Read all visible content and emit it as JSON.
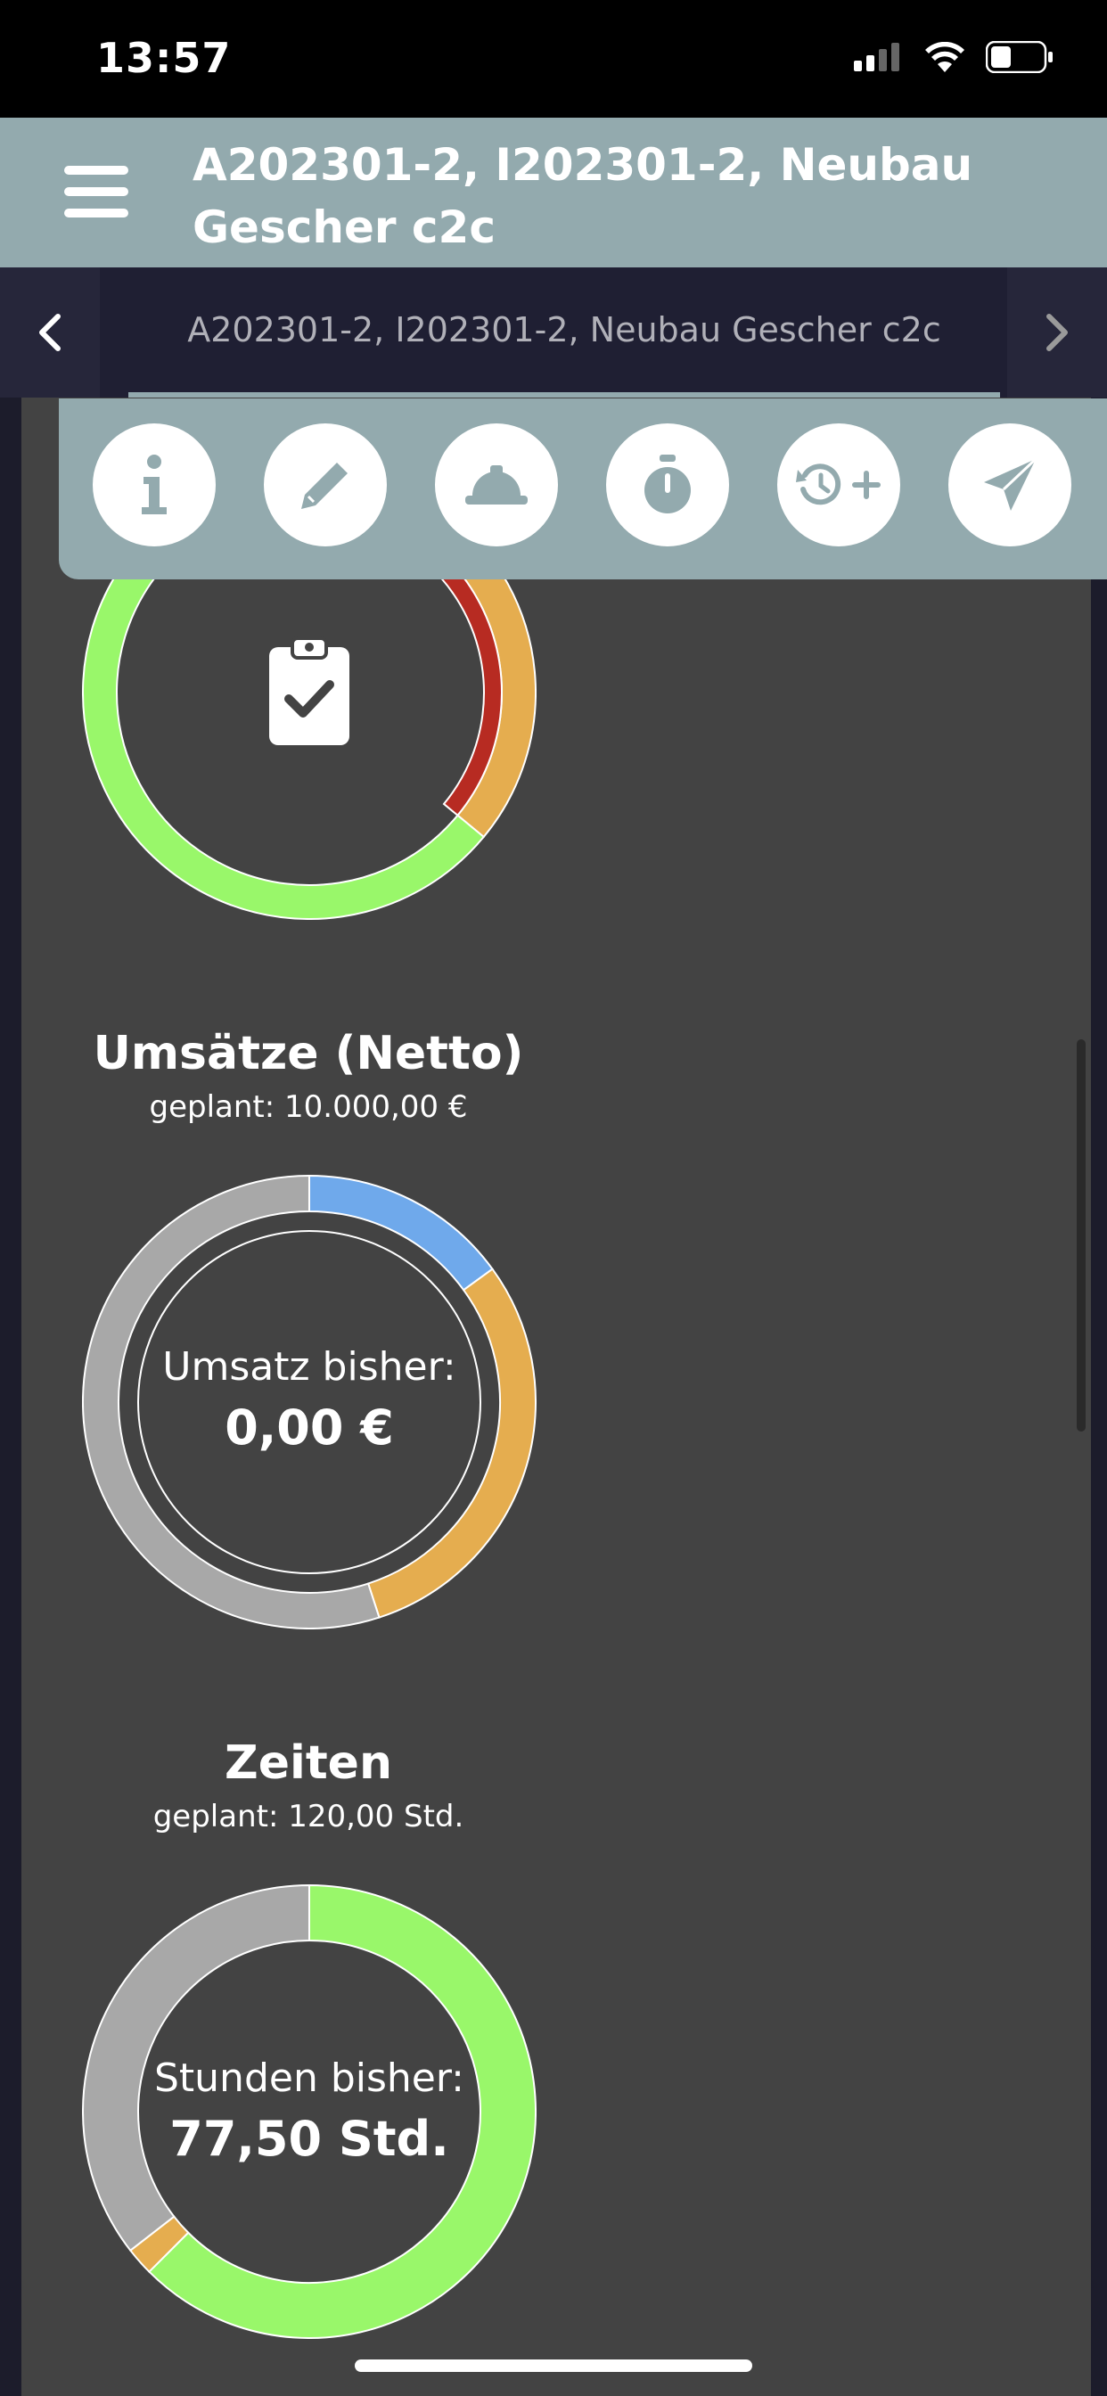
{
  "status_bar": {
    "time": "13:57",
    "icons": [
      "cellular-signal-icon",
      "wifi-icon",
      "battery-icon"
    ]
  },
  "header": {
    "title": "A202301-2, I202301-2, Neubau Gescher c2c",
    "menu_icon": "hamburger-menu-icon"
  },
  "tabs": {
    "prev_icon": "chevron-left-icon",
    "next_icon": "chevron-right-icon",
    "active_label": "A202301-2, I202301-2, Neubau Gescher c2c"
  },
  "actions": [
    {
      "name": "info-icon"
    },
    {
      "name": "pencil-icon"
    },
    {
      "name": "hard-hat-icon"
    },
    {
      "name": "stopwatch-icon"
    },
    {
      "name": "history-add-icon"
    },
    {
      "name": "paper-plane-icon"
    }
  ],
  "colors": {
    "header": "#93aaae",
    "background": "#434343",
    "green": "#99f76a",
    "orange": "#e5ad4f",
    "blue": "#6fa9eb",
    "red": "#b72b22",
    "gray": "#a8a8a8"
  },
  "sections": {
    "tasks": {
      "icon": "clipboard-check-icon"
    },
    "revenue": {
      "title": "Umsätze (Netto)",
      "subtitle": "geplant: 10.000,00 €",
      "center_label": "Umsatz bisher:",
      "center_value": "0,00 €"
    },
    "time": {
      "title": "Zeiten",
      "subtitle": "geplant: 120,00 Std.",
      "center_label": "Stunden bisher:",
      "center_value": "77,50 Std."
    }
  },
  "chart_data": [
    {
      "type": "pie",
      "chart": "tasks",
      "outer_ring": [
        {
          "color": "#6fa9eb",
          "fraction": 0.11
        },
        {
          "color": "#e5ad4f",
          "fraction": 0.25
        },
        {
          "color": "#99f76a",
          "fraction": 0.64
        }
      ],
      "inner_ring": [
        {
          "color": "#b72b22",
          "fraction": 0.36
        }
      ]
    },
    {
      "type": "pie",
      "chart": "revenue",
      "outer_ring": [
        {
          "color": "#6fa9eb",
          "fraction": 0.15
        },
        {
          "color": "#e5ad4f",
          "fraction": 0.3
        },
        {
          "color": "#a8a8a8",
          "fraction": 0.55
        }
      ],
      "inner_ring": [
        {
          "color": "#a8a8a8",
          "fraction": 0.0
        }
      ]
    },
    {
      "type": "pie",
      "chart": "time",
      "outer_ring": [
        {
          "color": "#99f76a",
          "fraction": 0.625
        },
        {
          "color": "#e5ad4f",
          "fraction": 0.02
        },
        {
          "color": "#a8a8a8",
          "fraction": 0.355
        }
      ]
    }
  ]
}
